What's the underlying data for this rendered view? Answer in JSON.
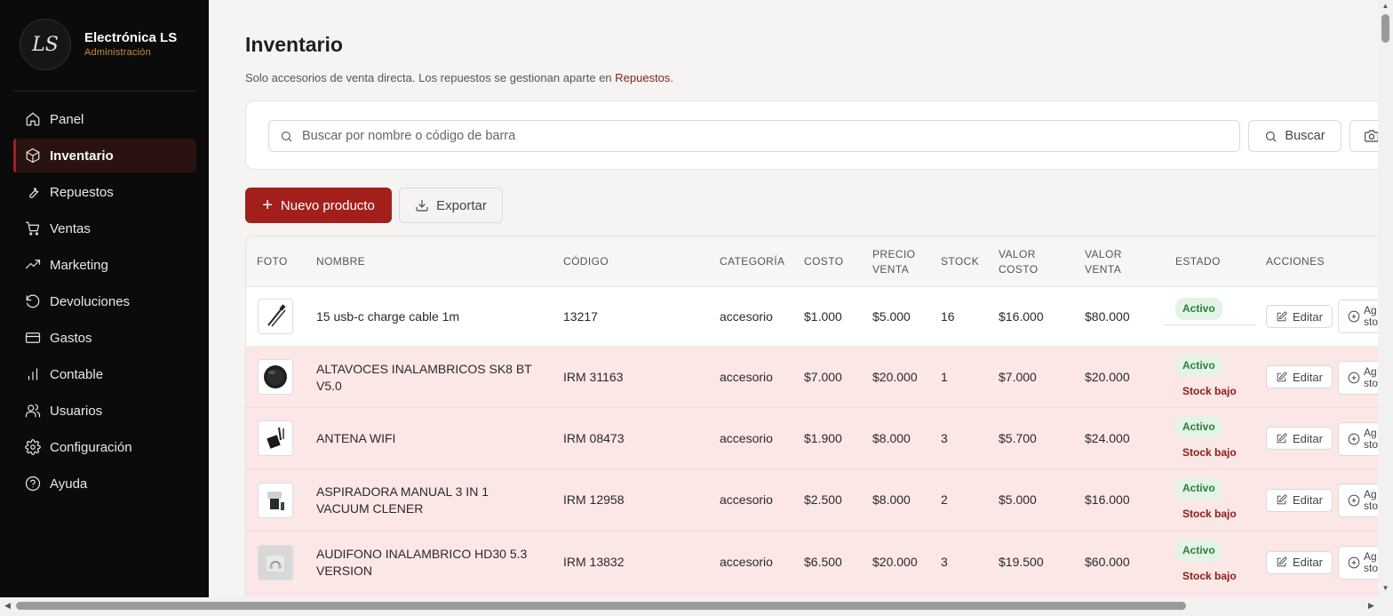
{
  "brand": {
    "name": "Electrónica LS",
    "subtitle": "Administración",
    "logo_text": "LS"
  },
  "sidebar": {
    "items": [
      {
        "label": "Panel",
        "icon": "home-icon"
      },
      {
        "label": "Inventario",
        "icon": "box-icon",
        "active": true
      },
      {
        "label": "Repuestos",
        "icon": "wrench-icon"
      },
      {
        "label": "Ventas",
        "icon": "cart-icon"
      },
      {
        "label": "Marketing",
        "icon": "trending-up-icon"
      },
      {
        "label": "Devoluciones",
        "icon": "rotate-ccw-icon"
      },
      {
        "label": "Gastos",
        "icon": "credit-card-icon"
      },
      {
        "label": "Contable",
        "icon": "bar-chart-icon"
      },
      {
        "label": "Usuarios",
        "icon": "users-icon"
      },
      {
        "label": "Configuración",
        "icon": "gear-icon"
      },
      {
        "label": "Ayuda",
        "icon": "help-circle-icon"
      }
    ]
  },
  "page": {
    "title": "Inventario",
    "subtitle_prefix": "Solo accesorios de venta directa. Los repuestos se gestionan aparte en ",
    "subtitle_link": "Repuestos",
    "subtitle_suffix": "."
  },
  "search": {
    "placeholder": "Buscar por nombre o código de barra",
    "value": "",
    "button_label": "Buscar"
  },
  "toolbar": {
    "new_label": "Nuevo producto",
    "export_label": "Exportar"
  },
  "table": {
    "headers": {
      "foto": "FOTO",
      "nombre": "NOMBRE",
      "codigo": "CÓDIGO",
      "categoria": "CATEGORÍA",
      "costo": "COSTO",
      "precio_venta_1": "PRECIO",
      "precio_venta_2": "VENTA",
      "stock": "STOCK",
      "valor_costo_1": "VALOR",
      "valor_costo_2": "COSTO",
      "valor_venta_1": "VALOR",
      "valor_venta_2": "VENTA",
      "estado": "ESTADO",
      "acciones": "ACCIONES"
    },
    "edit_label": "Editar",
    "add_stock_label_1": "Ag",
    "add_stock_label_2": "sto",
    "rows": [
      {
        "nombre_1": "15 usb-c charge cable 1m",
        "nombre_2": "",
        "codigo": "13217",
        "categoria": "accesorio",
        "costo": "$1.000",
        "precio_venta": "$5.000",
        "stock": "16",
        "valor_costo": "$16.000",
        "valor_venta": "$80.000",
        "estado": "Activo",
        "alerta": ""
      },
      {
        "nombre_1": "ALTAVOCES INALAMBRICOS SK8 BT",
        "nombre_2": "V5.0",
        "codigo": "IRM 31163",
        "categoria": "accesorio",
        "costo": "$7.000",
        "precio_venta": "$20.000",
        "stock": "1",
        "valor_costo": "$7.000",
        "valor_venta": "$20.000",
        "estado": "Activo",
        "alerta": "Stock bajo"
      },
      {
        "nombre_1": "ANTENA WIFI",
        "nombre_2": "",
        "codigo": "IRM 08473",
        "categoria": "accesorio",
        "costo": "$1.900",
        "precio_venta": "$8.000",
        "stock": "3",
        "valor_costo": "$5.700",
        "valor_venta": "$24.000",
        "estado": "Activo",
        "alerta": "Stock bajo"
      },
      {
        "nombre_1": "ASPIRADORA MANUAL 3 IN 1",
        "nombre_2": "VACUUM CLENER",
        "codigo": "IRM 12958",
        "categoria": "accesorio",
        "costo": "$2.500",
        "precio_venta": "$8.000",
        "stock": "2",
        "valor_costo": "$5.000",
        "valor_venta": "$16.000",
        "estado": "Activo",
        "alerta": "Stock bajo"
      },
      {
        "nombre_1": "AUDIFONO INALAMBRICO HD30 5.3",
        "nombre_2": "VERSION",
        "codigo": "IRM 13832",
        "categoria": "accesorio",
        "costo": "$6.500",
        "precio_venta": "$20.000",
        "stock": "3",
        "valor_costo": "$19.500",
        "valor_venta": "$60.000",
        "estado": "Activo",
        "alerta": "Stock bajo"
      }
    ]
  },
  "colors": {
    "accent": "#a31f1c",
    "sidebar_bg": "#0b0b0b",
    "low_stock_row": "#fbe7e6",
    "active_badge": "#2e7d3f",
    "brand_sub": "#c98a3c"
  }
}
